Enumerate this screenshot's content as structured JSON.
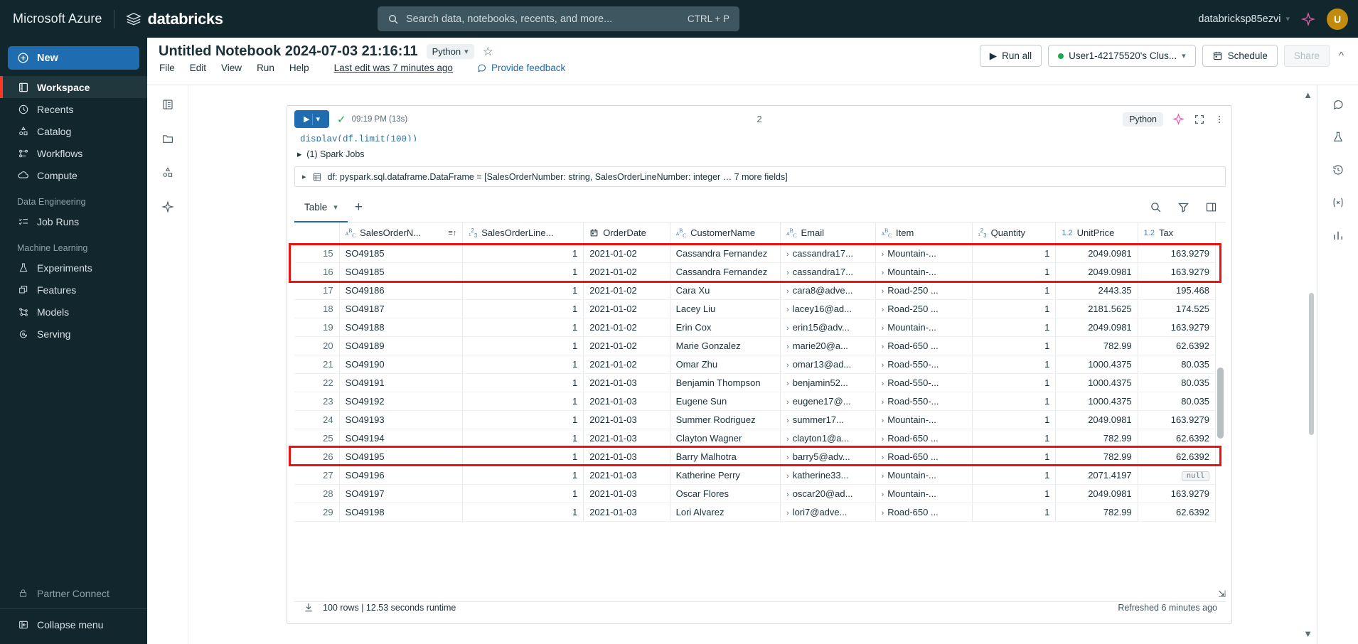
{
  "topbar": {
    "azure_label": "Microsoft Azure",
    "databricks_label": "databricks",
    "search_placeholder": "Search data, notebooks, recents, and more...",
    "search_shortcut": "CTRL + P",
    "account_name": "databricksp85ezvi",
    "avatar_initial": "U"
  },
  "sidebar": {
    "new_label": "New",
    "items": [
      {
        "label": "Workspace",
        "icon": "workspace-icon",
        "active": true
      },
      {
        "label": "Recents",
        "icon": "clock-icon",
        "active": false
      },
      {
        "label": "Catalog",
        "icon": "catalog-icon",
        "active": false
      },
      {
        "label": "Workflows",
        "icon": "workflows-icon",
        "active": false
      },
      {
        "label": "Compute",
        "icon": "cloud-icon",
        "active": false
      }
    ],
    "section_data_engineering": "Data Engineering",
    "data_engineering_items": [
      {
        "label": "Job Runs",
        "icon": "job-runs-icon"
      }
    ],
    "section_machine_learning": "Machine Learning",
    "machine_learning_items": [
      {
        "label": "Experiments",
        "icon": "experiments-icon"
      },
      {
        "label": "Features",
        "icon": "features-icon"
      },
      {
        "label": "Models",
        "icon": "models-icon"
      },
      {
        "label": "Serving",
        "icon": "serving-icon"
      }
    ],
    "partner_connect": "Partner Connect",
    "collapse_menu": "Collapse menu"
  },
  "notebook": {
    "title": "Untitled Notebook 2024-07-03 21:16:11",
    "language": "Python",
    "menu": [
      "File",
      "Edit",
      "View",
      "Run",
      "Help"
    ],
    "last_edit": "Last edit was 7 minutes ago",
    "provide_feedback": "Provide feedback",
    "run_all": "Run all",
    "cluster": "User1-42175520's Clus...",
    "schedule": "Schedule",
    "share": "Share"
  },
  "cell": {
    "run_time_label": "09:19 PM (13s)",
    "cell_number": "2",
    "language_chip": "Python",
    "code_line": "display(df.limit(100))",
    "spark_jobs": "(1) Spark Jobs",
    "dataframe_line": "df:  pyspark.sql.dataframe.DataFrame = [SalesOrderNumber: string, SalesOrderLineNumber: integer … 7 more fields]"
  },
  "result_tabs": {
    "table_label": "Table",
    "add_label": "+"
  },
  "table": {
    "columns": [
      {
        "name": "SalesOrderN...",
        "type_icon": "string",
        "sorted": true
      },
      {
        "name": "SalesOrderLine...",
        "type_icon": "integer",
        "sorted": false
      },
      {
        "name": "OrderDate",
        "type_icon": "date",
        "sorted": false
      },
      {
        "name": "CustomerName",
        "type_icon": "string",
        "sorted": false
      },
      {
        "name": "Email",
        "type_icon": "string",
        "sorted": false
      },
      {
        "name": "Item",
        "type_icon": "string",
        "sorted": false
      },
      {
        "name": "Quantity",
        "type_icon": "integer",
        "sorted": false
      },
      {
        "name": "UnitPrice",
        "type_icon": "decimal",
        "sorted": false
      },
      {
        "name": "Tax",
        "type_icon": "decimal",
        "sorted": false
      }
    ],
    "rows": [
      {
        "idx": "15",
        "order": "SO49185",
        "line": "1",
        "date": "2021-01-02",
        "customer": "Cassandra Fernandez",
        "email": "cassandra17...",
        "item": "Mountain-...",
        "qty": "1",
        "price": "2049.0981",
        "tax": "163.9279",
        "highlight": true
      },
      {
        "idx": "16",
        "order": "SO49185",
        "line": "1",
        "date": "2021-01-02",
        "customer": "Cassandra Fernandez",
        "email": "cassandra17...",
        "item": "Mountain-...",
        "qty": "1",
        "price": "2049.0981",
        "tax": "163.9279",
        "highlight": true
      },
      {
        "idx": "17",
        "order": "SO49186",
        "line": "1",
        "date": "2021-01-02",
        "customer": "Cara Xu",
        "email": "cara8@adve...",
        "item": "Road-250 ...",
        "qty": "1",
        "price": "2443.35",
        "tax": "195.468",
        "highlight": false
      },
      {
        "idx": "18",
        "order": "SO49187",
        "line": "1",
        "date": "2021-01-02",
        "customer": "Lacey Liu",
        "email": "lacey16@ad...",
        "item": "Road-250 ...",
        "qty": "1",
        "price": "2181.5625",
        "tax": "174.525",
        "highlight": false
      },
      {
        "idx": "19",
        "order": "SO49188",
        "line": "1",
        "date": "2021-01-02",
        "customer": "Erin Cox",
        "email": "erin15@adv...",
        "item": "Mountain-...",
        "qty": "1",
        "price": "2049.0981",
        "tax": "163.9279",
        "highlight": false
      },
      {
        "idx": "20",
        "order": "SO49189",
        "line": "1",
        "date": "2021-01-02",
        "customer": "Marie Gonzalez",
        "email": "marie20@a...",
        "item": "Road-650 ...",
        "qty": "1",
        "price": "782.99",
        "tax": "62.6392",
        "highlight": false
      },
      {
        "idx": "21",
        "order": "SO49190",
        "line": "1",
        "date": "2021-01-02",
        "customer": "Omar Zhu",
        "email": "omar13@ad...",
        "item": "Road-550-...",
        "qty": "1",
        "price": "1000.4375",
        "tax": "80.035",
        "highlight": false
      },
      {
        "idx": "22",
        "order": "SO49191",
        "line": "1",
        "date": "2021-01-03",
        "customer": "Benjamin Thompson",
        "email": "benjamin52...",
        "item": "Road-550-...",
        "qty": "1",
        "price": "1000.4375",
        "tax": "80.035",
        "highlight": false
      },
      {
        "idx": "23",
        "order": "SO49192",
        "line": "1",
        "date": "2021-01-03",
        "customer": "Eugene Sun",
        "email": "eugene17@...",
        "item": "Road-550-...",
        "qty": "1",
        "price": "1000.4375",
        "tax": "80.035",
        "highlight": false
      },
      {
        "idx": "24",
        "order": "SO49193",
        "line": "1",
        "date": "2021-01-03",
        "customer": "Summer Rodriguez",
        "email": "summer17...",
        "item": "Mountain-...",
        "qty": "1",
        "price": "2049.0981",
        "tax": "163.9279",
        "highlight": false
      },
      {
        "idx": "25",
        "order": "SO49194",
        "line": "1",
        "date": "2021-01-03",
        "customer": "Clayton Wagner",
        "email": "clayton1@a...",
        "item": "Road-650 ...",
        "qty": "1",
        "price": "782.99",
        "tax": "62.6392",
        "highlight": false
      },
      {
        "idx": "26",
        "order": "SO49195",
        "line": "1",
        "date": "2021-01-03",
        "customer": "Barry Malhotra",
        "email": "barry5@adv...",
        "item": "Road-650 ...",
        "qty": "1",
        "price": "782.99",
        "tax": "62.6392",
        "highlight": false
      },
      {
        "idx": "27",
        "order": "SO49196",
        "line": "1",
        "date": "2021-01-03",
        "customer": "Katherine Perry",
        "email": "katherine33...",
        "item": "Mountain-...",
        "qty": "1",
        "price": "2071.4197",
        "tax": "null",
        "highlight": true
      },
      {
        "idx": "28",
        "order": "SO49197",
        "line": "1",
        "date": "2021-01-03",
        "customer": "Oscar Flores",
        "email": "oscar20@ad...",
        "item": "Mountain-...",
        "qty": "1",
        "price": "2049.0981",
        "tax": "163.9279",
        "highlight": false
      },
      {
        "idx": "29",
        "order": "SO49198",
        "line": "1",
        "date": "2021-01-03",
        "customer": "Lori Alvarez",
        "email": "lori7@adve...",
        "item": "Road-650 ...",
        "qty": "1",
        "price": "782.99",
        "tax": "62.6392",
        "highlight": false
      }
    ],
    "footer_rows": "100 rows  |  12.53 seconds runtime",
    "footer_refreshed": "Refreshed 6 minutes ago"
  },
  "colors": {
    "nav_bg": "#11262d",
    "accent_blue": "#1f6cb0",
    "accent_red": "#ff3621",
    "highlight_red": "#ee1111",
    "green": "#1aab4b"
  }
}
